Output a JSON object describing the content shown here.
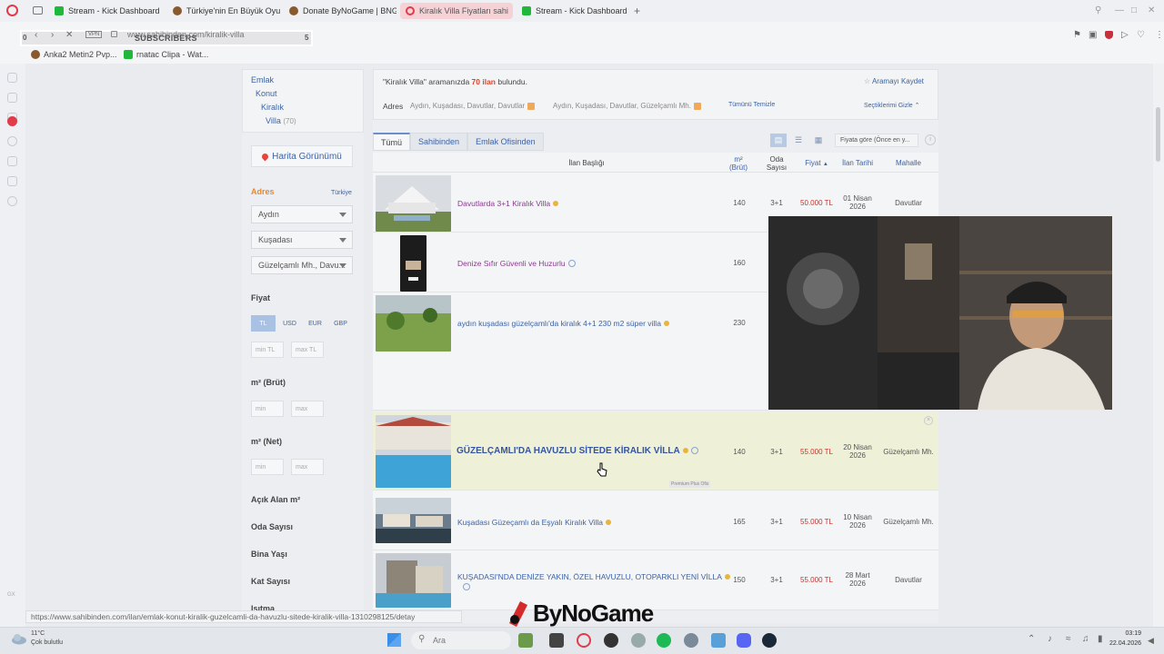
{
  "browser": {
    "tabs": [
      {
        "label": "Stream - Kick Dashboard",
        "favicon": "kick-icon"
      },
      {
        "label": "Türkiye'nin En Büyük Oyu",
        "favicon": "avatar-icon"
      },
      {
        "label": "Donate ByNoGame | BNG",
        "favicon": "avatar-icon"
      },
      {
        "label": "Kiralık Villa Fiyatları sahi",
        "favicon": "opera-icon"
      },
      {
        "label": "Stream - Kick Dashboard",
        "favicon": "kick-icon"
      }
    ],
    "new_tab": "+",
    "url": "www.sahibinden.com/kiralik-villa",
    "vpn": "VPN",
    "overlay": {
      "left_num": "0",
      "title": "SUBSCRIBERS",
      "right_num": "5"
    },
    "bookmarks": [
      {
        "label": "Anka2 Metin2 Pvp..."
      },
      {
        "label": "rnatac Clipa - Wat..."
      }
    ],
    "status_url": "https://www.sahibinden.com/ilan/emlak-konut-kiralik-guzelcamli-da-havuzlu-sitede-kiralik-villa-1310298125/detay"
  },
  "sidebar": {
    "categories": [
      {
        "label": "Emlak"
      },
      {
        "label": "Konut"
      },
      {
        "label": "Kiralık"
      },
      {
        "label": "Villa",
        "count": "(70)"
      }
    ],
    "map_button": "Harita Görünümü",
    "address_label": "Adres",
    "country_link": "Türkiye",
    "selects": [
      "Aydın",
      "Kuşadası",
      "Güzelçamlı Mh., Davu..."
    ],
    "price_label": "Fiyat",
    "currencies": [
      "TL",
      "USD",
      "EUR",
      "GBP"
    ],
    "price_min": "min TL",
    "price_max": "max TL",
    "area_gross_label": "m² (Brüt)",
    "area_net_label": "m² (Net)",
    "min": "min",
    "max": "max",
    "open_area_label": "Açık Alan m²",
    "rooms_label": "Oda Sayısı",
    "building_age_label": "Bina Yaşı",
    "floors_label": "Kat Sayısı",
    "heating_label": "Isıtma"
  },
  "results": {
    "summary_prefix": "\"Kiralık Villa\" aramanızda ",
    "summary_count": "70 ilan",
    "summary_suffix": " bulundu.",
    "save_search": "Aramayı Kaydet",
    "address_filter_label": "Adres",
    "chips": [
      "Aydın, Kuşadası, Davutlar, Davutlar",
      "Aydın, Kuşadası, Davutlar, Güzelçamlı Mh."
    ],
    "clear_all": "Tümünü Temizle",
    "hide_selected": "Seçtiklerimi Gizle",
    "tabs": [
      "Tümü",
      "Sahibinden",
      "Emlak Ofisinden"
    ],
    "sort": "Fiyata göre (Önce en y...",
    "columns": {
      "title": "İlan Başlığı",
      "area": "m² (Brüt)",
      "rooms": "Oda Sayısı",
      "price": "Fiyat",
      "date": "İlan Tarihi",
      "district": "Mahalle"
    },
    "listings": [
      {
        "title": "Davutlarda 3+1 Kiralık Villa",
        "area": "140",
        "rooms": "3+1",
        "price": "50.000 TL",
        "date1": "01 Nisan",
        "date2": "2026",
        "district": "Davutlar"
      },
      {
        "title": "Denize Sıfır Güvenli ve Huzurlu",
        "area": "160",
        "rooms": "",
        "price": "",
        "date1": "",
        "date2": "",
        "district": ""
      },
      {
        "title": "aydın kuşadası güzelçamlı'da kiralık 4+1 230 m2 süper villa",
        "area": "230",
        "rooms": "",
        "price": "",
        "date1": "",
        "date2": "",
        "district": ""
      },
      {
        "title": "GÜZELÇAMLI'DA HAVUZLU SİTEDE KİRALIK VİLLA",
        "area": "140",
        "rooms": "3+1",
        "price": "55.000 TL",
        "date1": "20 Nisan",
        "date2": "2026",
        "district": "Güzelçamlı Mh.",
        "tag": "Premium Plus Ofis"
      },
      {
        "title": "Kuşadası Güzeçamlı da Eşyalı Kiralık Villa",
        "area": "165",
        "rooms": "3+1",
        "price": "55.000 TL",
        "date1": "10 Nisan",
        "date2": "2026",
        "district": "Güzelçamlı Mh."
      },
      {
        "title": "KUŞADASI'NDA DENİZE YAKIN, ÖZEL HAVUZLU, OTOPARKLI YENİ VİLLA",
        "area": "150",
        "rooms": "3+1",
        "price": "55.000 TL",
        "date1": "28 Mart",
        "date2": "2026",
        "district": "Davutlar"
      }
    ]
  },
  "stream": {
    "brand": "ByNoGame"
  },
  "taskbar": {
    "temp": "11°C",
    "weather": "Çok bulutlu",
    "search": "Ara",
    "time": "03:19",
    "date": "22.04.2026"
  },
  "colors": {
    "accent_blue": "#3c63a6",
    "price_red": "#c4342d",
    "orange": "#e8892f"
  }
}
